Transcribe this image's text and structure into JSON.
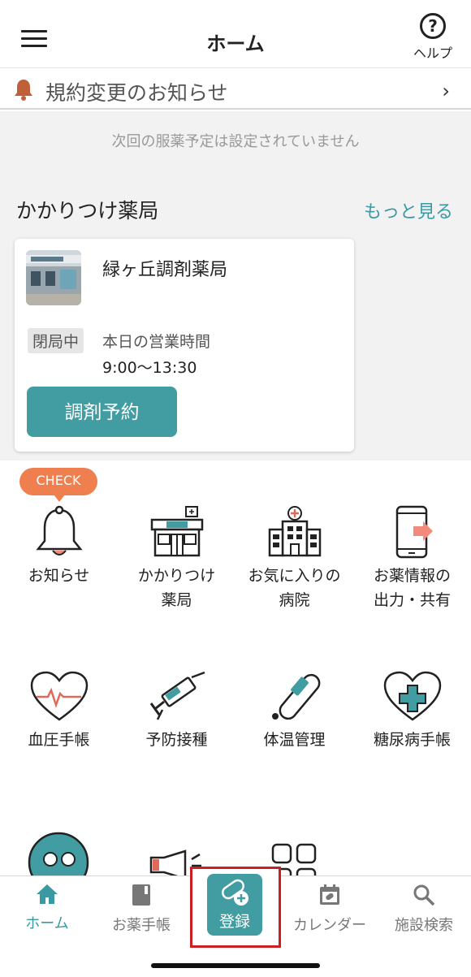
{
  "header": {
    "title": "ホーム",
    "help_icon": "?",
    "help_label": "ヘルプ"
  },
  "notice": {
    "text": "規約変更のお知らせ",
    "chevron": "›"
  },
  "next_dose": "次回の服薬予定は設定されていません",
  "pharmacy_section": {
    "title": "かかりつけ薬局",
    "more": "もっと見る"
  },
  "pharmacy": {
    "name": "緑ヶ丘調剤薬局",
    "status": "閉局中",
    "hours_label": "本日の営業時間",
    "hours": "9:00〜13:30",
    "reserve_button": "調剤予約"
  },
  "check_badge": "CHECK",
  "menu": [
    {
      "label": "お知らせ",
      "icon": "bell-icon"
    },
    {
      "label": "かかりつけ\n薬局",
      "icon": "pharmacy-icon"
    },
    {
      "label": "お気に入りの\n病院",
      "icon": "hospital-icon"
    },
    {
      "label": "お薬情報の\n出力・共有",
      "icon": "phone-share-icon"
    },
    {
      "label": "血圧手帳",
      "icon": "heart-pulse-icon"
    },
    {
      "label": "予防接種",
      "icon": "syringe-icon"
    },
    {
      "label": "体温管理",
      "icon": "thermometer-icon"
    },
    {
      "label": "糖尿病手帳",
      "icon": "heart-plus-icon"
    }
  ],
  "tabs": {
    "home": "ホーム",
    "notebook": "お薬手帳",
    "register": "登録",
    "calendar": "カレンダー",
    "search": "施設検索"
  },
  "colors": {
    "accent": "#419da2",
    "check": "#f07f4f",
    "highlight": "#cc1f1f"
  }
}
